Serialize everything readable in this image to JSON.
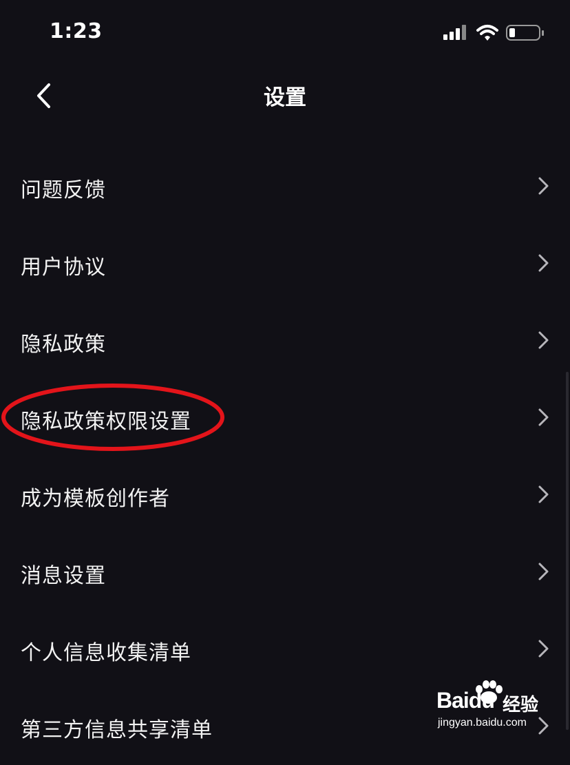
{
  "status_bar": {
    "time": "1:23"
  },
  "nav": {
    "title": "设置"
  },
  "settings_items": [
    {
      "label": "问题反馈"
    },
    {
      "label": "用户协议"
    },
    {
      "label": "隐私政策"
    },
    {
      "label": "隐私政策权限设置"
    },
    {
      "label": "成为模板创作者"
    },
    {
      "label": "消息设置"
    },
    {
      "label": "个人信息收集清单"
    },
    {
      "label": "第三方信息共享清单"
    }
  ],
  "annotation": {
    "color": "#e3141a",
    "highlighted_item": "隐私政策权限设置"
  },
  "watermark": {
    "logo": "Baidu",
    "logo_cn": "经验",
    "url": "jingyan.baidu.com"
  },
  "colors": {
    "background": "#111016",
    "text": "#f2f2f2",
    "chevron": "#b7b6bb"
  }
}
